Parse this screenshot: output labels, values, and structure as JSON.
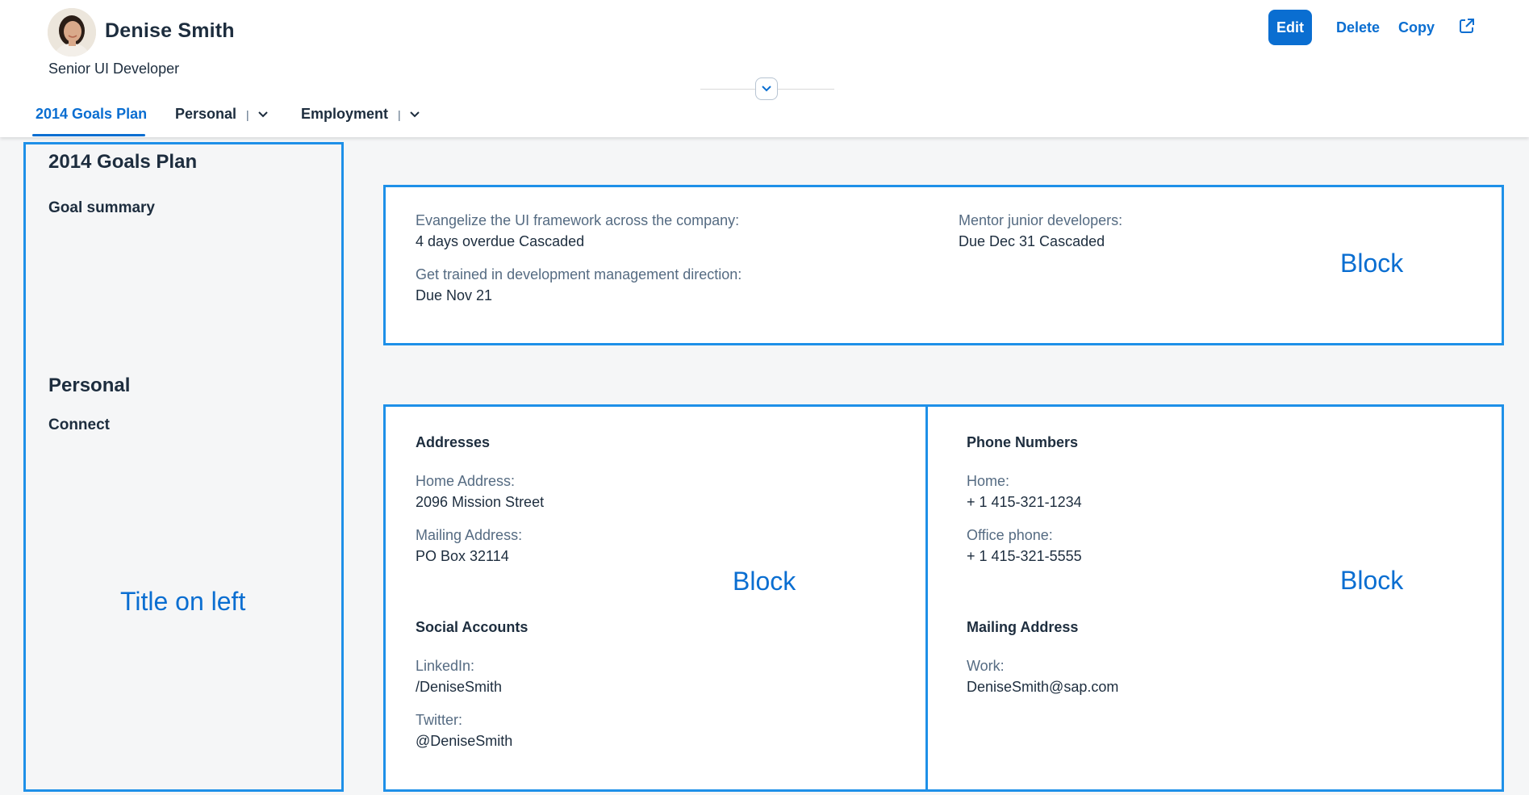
{
  "header": {
    "name": "Denise Smith",
    "role": "Senior UI Developer",
    "actions": {
      "edit": "Edit",
      "delete": "Delete",
      "copy": "Copy"
    }
  },
  "tabs": [
    {
      "label": "2014 Goals Plan",
      "selected": true
    },
    {
      "label": "Personal",
      "has_menu": true
    },
    {
      "label": "Employment",
      "has_menu": true
    }
  ],
  "left": {
    "goals_title": "2014 Goals Plan",
    "goals_sub": "Goal summary",
    "personal_title": "Personal",
    "personal_sub": "Connect",
    "annotation": "Title on left"
  },
  "goals_block": {
    "annotation": "Block",
    "items": [
      {
        "label": "Evangelize the UI framework across the company:",
        "value": "4 days overdue Cascaded"
      },
      {
        "label": "Get trained in development management direction:",
        "value": "Due Nov 21"
      },
      {
        "label": "Mentor junior developers:",
        "value": "Due Dec 31 Cascaded"
      }
    ]
  },
  "connect_left": {
    "annotation": "Block",
    "addresses_title": "Addresses",
    "addresses": [
      {
        "label": "Home Address:",
        "value": "2096 Mission Street"
      },
      {
        "label": "Mailing Address:",
        "value": "PO Box 32114"
      }
    ],
    "social_title": "Social Accounts",
    "social": [
      {
        "label": "LinkedIn:",
        "value": "/DeniseSmith"
      },
      {
        "label": "Twitter:",
        "value": "@DeniseSmith"
      }
    ]
  },
  "connect_right": {
    "annotation": "Block",
    "phones_title": "Phone Numbers",
    "phones": [
      {
        "label": "Home:",
        "value": "+ 1 415-321-1234"
      },
      {
        "label": "Office phone:",
        "value": "+ 1 415-321-5555"
      }
    ],
    "mailing_title": "Mailing Address",
    "mailing": [
      {
        "label": "Work:",
        "value": "DeniseSmith@sap.com"
      }
    ]
  },
  "colors": {
    "accent": "#0a6ed1",
    "annotation_border": "#1e90e8",
    "text": "#1d2d3e",
    "label": "#556b82"
  },
  "icons": [
    "avatar",
    "chevron-down-icon",
    "share-icon",
    "collapse-header-icon"
  ]
}
